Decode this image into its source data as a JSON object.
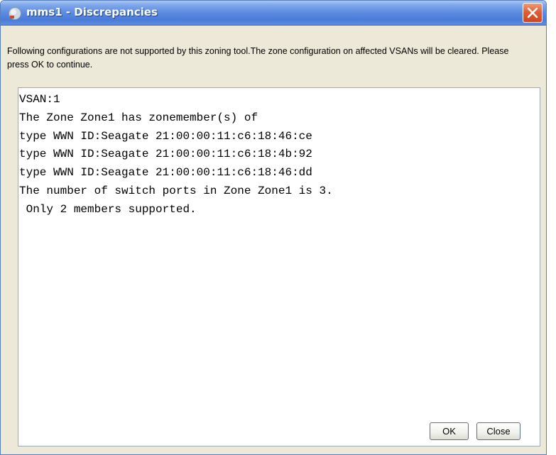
{
  "window": {
    "title": "mms1 - Discrepancies",
    "close_icon": "close-x-icon",
    "app_icon": "globe-icon"
  },
  "message": "Following configurations are not supported by this zoning tool.The zone configuration on affected VSANs will be cleared.  Please press OK to continue.",
  "details": {
    "lines": [
      "VSAN:1",
      "The Zone Zone1 has zonemember(s) of",
      "type WWN ID:Seagate 21:00:00:11:c6:18:46:ce",
      "type WWN ID:Seagate 21:00:00:11:c6:18:4b:92",
      "type WWN ID:Seagate 21:00:00:11:c6:18:46:dd",
      "The number of switch ports in Zone Zone1 is 3.",
      " Only 2 members supported."
    ]
  },
  "buttons": {
    "ok_label": "OK",
    "close_label": "Close"
  },
  "colors": {
    "titlebar": "#4a7bd8",
    "close_button": "#e35d33",
    "dialog_bg": "#ece9d8"
  }
}
